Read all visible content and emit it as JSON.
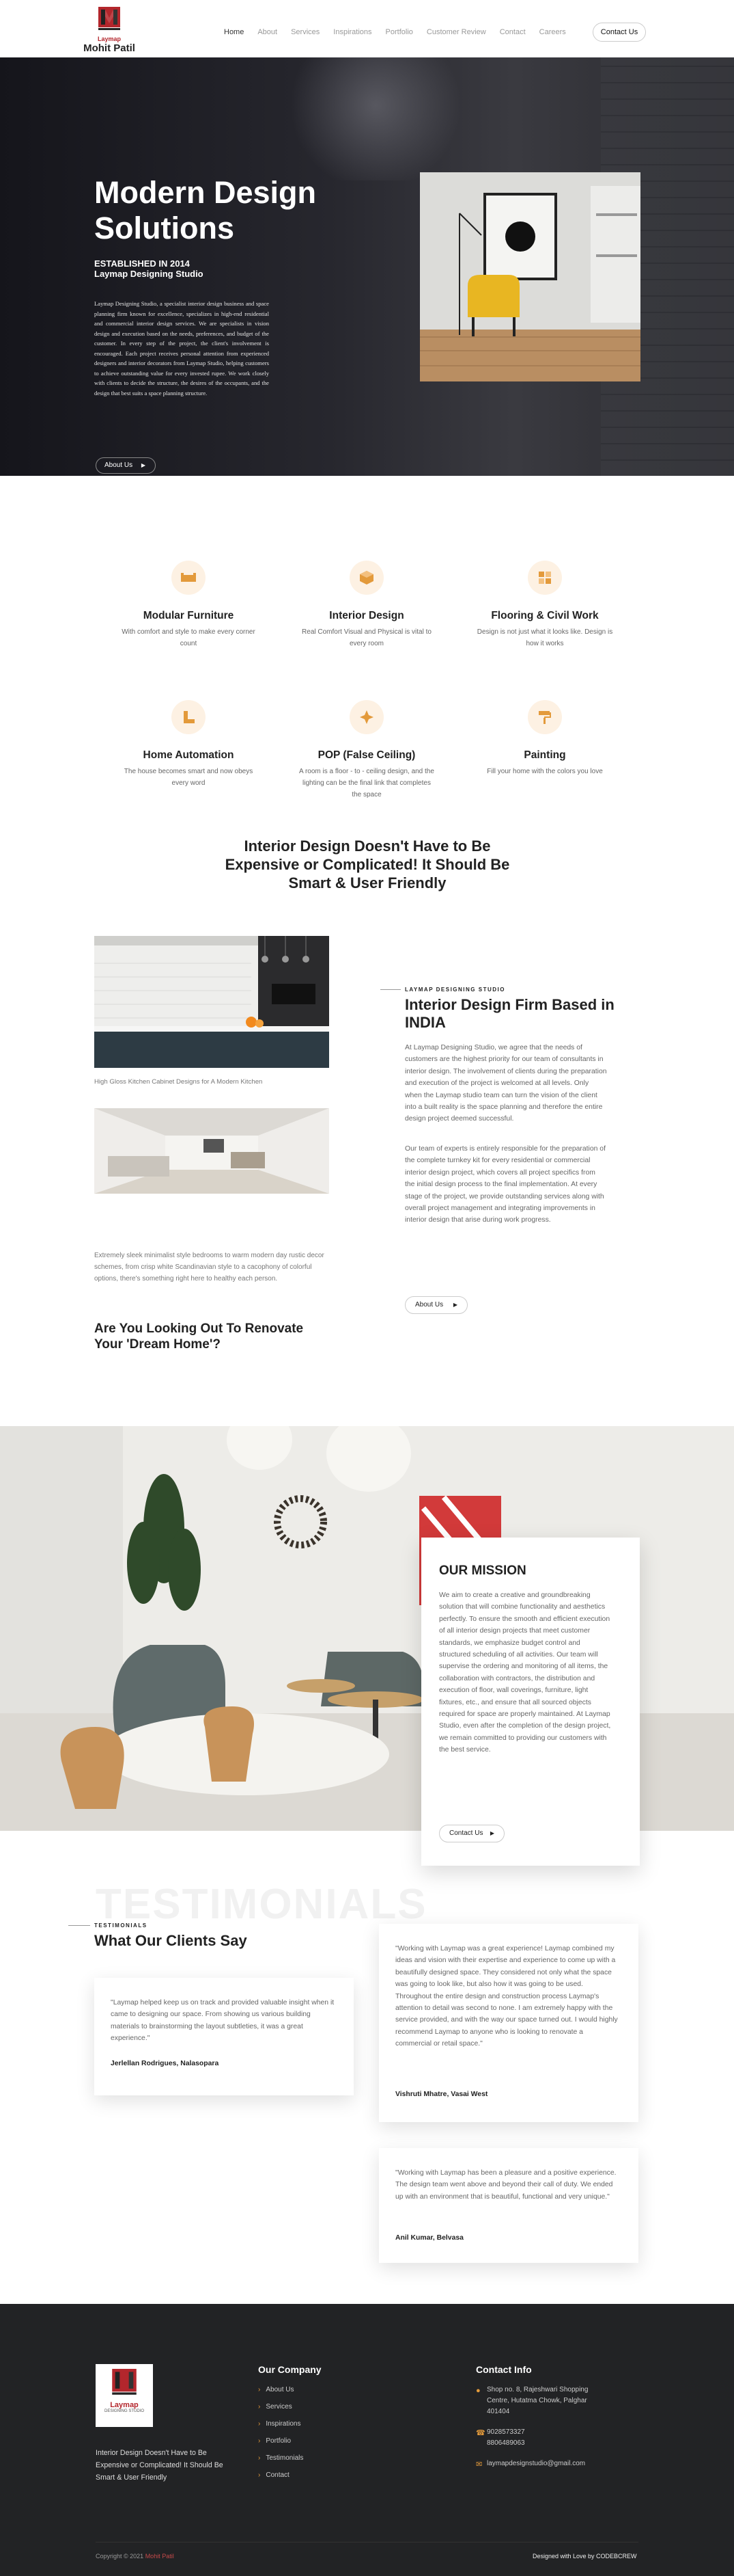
{
  "header": {
    "logo_brand": "Laymap",
    "logo_name": "Mohit Patil",
    "nav": [
      "Home",
      "About",
      "Services",
      "Inspirations",
      "Portfolio",
      "Customer Review",
      "Contact",
      "Careers"
    ],
    "contact_button": "Contact Us"
  },
  "hero": {
    "title": "Modern Design Solutions",
    "established": "ESTABLISHED IN 2014",
    "studio": "Laymap Designing Studio",
    "description": "Laymap Designing Studio, a specialist interior design business and space planning firm known for excellence, specializes in high-end residential and commercial interior design services. We are specialists in vision design and execution based on the needs, preferences, and budget of the customer. In every step of the project, the client's involvement is encouraged. Each project receives personal attention from experienced designers and interior decorators from Laymap Studio, helping customers to achieve outstanding value for every invested rupee. We work closely with clients to decide the structure, the desires of the occupants, and the design that best suits a space planning structure.",
    "button": "About Us"
  },
  "services": [
    {
      "icon": "furniture-icon",
      "title": "Modular Furniture",
      "desc": "With comfort and style to make every corner count"
    },
    {
      "icon": "cube-icon",
      "title": "Interior Design",
      "desc": "Real Comfort Visual and Physical is vital to every room"
    },
    {
      "icon": "floor-icon",
      "title": "Flooring & Civil Work",
      "desc": "Design is not just what it looks like. Design is how it works"
    },
    {
      "icon": "pipe-icon",
      "title": "Home Automation",
      "desc": "The house becomes smart and now obeys every word"
    },
    {
      "icon": "ceiling-icon",
      "title": "POP (False Ceiling)",
      "desc": "A room is a floor - to - ceiling design, and the lighting can be the final link that completes the space"
    },
    {
      "icon": "paint-roller-icon",
      "title": "Painting",
      "desc": "Fill your home with the colors you love"
    }
  ],
  "intro_heading": "Interior Design Doesn't Have to Be Expensive or Complicated! It Should Be Smart & User Friendly",
  "about": {
    "caption1": "High Gloss Kitchen Cabinet Designs for A Modern Kitchen",
    "caption2": "Extremely sleek minimalist style bedrooms to warm modern day rustic decor schemes, from crisp white Scandinavian style to a cacophony of colorful options, there's something right here to healthy each person.",
    "question": "Are You Looking Out To Renovate Your 'Dream Home'?",
    "eyebrow": "LAYMAP DESIGNING STUDIO",
    "title": "Interior Design Firm Based in INDIA",
    "para1": "At Laymap Designing Studio, we agree that the needs of customers are the highest priority for our team of consultants in interior design. The involvement of clients during the preparation and execution of the project is welcomed at all levels. Only when the Laymap studio team can turn the vision of the client into a built reality is the space planning and therefore the entire design project deemed successful.",
    "para2": "Our team of experts is entirely responsible for the preparation of the complete turnkey kit for every residential or commercial interior design project, which covers all project specifics from the initial design process to the final implementation. At every stage of the project, we provide outstanding services along with overall project management and integrating improvements in interior design that arise during work progress.",
    "button": "About Us"
  },
  "mission": {
    "title": "OUR MISSION",
    "text": "We aim to create a creative and groundbreaking solution that will combine functionality and aesthetics perfectly. To ensure the smooth and efficient execution of all interior design projects that meet customer standards, we emphasize budget control and structured scheduling of all activities. Our team will supervise the ordering and monitoring of all items, the collaboration with contractors, the distribution and execution of floor, wall coverings, furniture, light fixtures, etc., and ensure that all sourced objects required for space are properly maintained. At Laymap Studio, even after the completion of the design project, we remain committed to providing our customers with the best service.",
    "button": "Contact Us"
  },
  "testimonials": {
    "bg_word": "TESTIMONIALS",
    "eyebrow": "TESTIMONIALS",
    "title": "What Our Clients Say",
    "items": [
      {
        "quote": "\"Laymap helped keep us on track and provided valuable insight when it came to designing our space. From showing us various building materials to brainstorming the layout subtleties, it was a great experience.\"",
        "author": "Jerlellan Rodrigues, Nalasopara"
      },
      {
        "quote": "\"Working with Laymap was a great experience! Laymap combined my ideas and vision with their expertise and experience to come up with a beautifully designed space. They considered not only what the space was going to look like, but also how it was going to be used. Throughout the entire design and construction process Laymap's attention to detail was second to none. I am extremely happy with the service provided, and with the way our space turned out. I would highly recommend Laymap to anyone who is looking to renovate a commercial or retail space.\"",
        "author": "Vishruti Mhatre, Vasai West"
      },
      {
        "quote": "\"Working with Laymap has been a pleasure and a positive experience. The design team went above and beyond their call of duty. We ended up with an environment that is beautiful, functional and very unique.\"",
        "author": "Anil Kumar, Belvasa"
      }
    ]
  },
  "footer": {
    "logo_brand": "Laymap",
    "logo_sub": "DESIGNING STUDIO",
    "tagline": "Interior Design Doesn't Have to Be Expensive or Complicated! It Should Be Smart & User Friendly",
    "company_heading": "Our Company",
    "links": [
      "About Us",
      "Services",
      "Inspirations",
      "Portfolio",
      "Testimonials",
      "Contact"
    ],
    "contact_heading": "Contact Info",
    "address": "Shop no. 8, Rajeshwari Shopping Centre, Hutatma Chowk, Palghar 401404",
    "phone": "9028573327 8806489063",
    "email": "laymapdesignstudio@gmail.com",
    "copyright_prefix": "Copyright © 2021 ",
    "copyright_name": "Mohit Patil",
    "credit": "Designed with Love by CODEBCREW"
  },
  "colors": {
    "accent": "#e39a3b",
    "brand_red": "#b3262c",
    "dark": "#222325"
  }
}
